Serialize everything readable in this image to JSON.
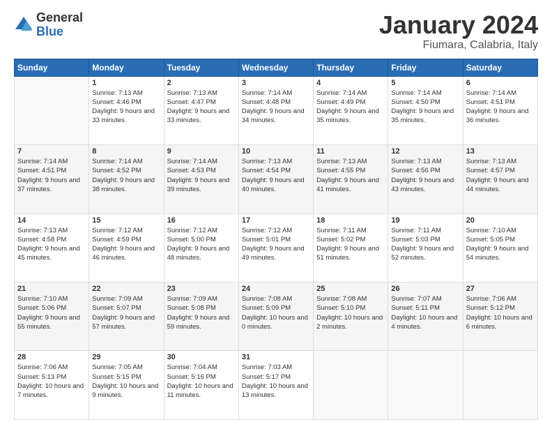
{
  "logo": {
    "general": "General",
    "blue": "Blue"
  },
  "title": "January 2024",
  "location": "Fiumara, Calabria, Italy",
  "headers": [
    "Sunday",
    "Monday",
    "Tuesday",
    "Wednesday",
    "Thursday",
    "Friday",
    "Saturday"
  ],
  "weeks": [
    [
      {
        "day": "",
        "sunrise": "",
        "sunset": "",
        "daylight": ""
      },
      {
        "day": "1",
        "sunrise": "Sunrise: 7:13 AM",
        "sunset": "Sunset: 4:46 PM",
        "daylight": "Daylight: 9 hours and 33 minutes."
      },
      {
        "day": "2",
        "sunrise": "Sunrise: 7:13 AM",
        "sunset": "Sunset: 4:47 PM",
        "daylight": "Daylight: 9 hours and 33 minutes."
      },
      {
        "day": "3",
        "sunrise": "Sunrise: 7:14 AM",
        "sunset": "Sunset: 4:48 PM",
        "daylight": "Daylight: 9 hours and 34 minutes."
      },
      {
        "day": "4",
        "sunrise": "Sunrise: 7:14 AM",
        "sunset": "Sunset: 4:49 PM",
        "daylight": "Daylight: 9 hours and 35 minutes."
      },
      {
        "day": "5",
        "sunrise": "Sunrise: 7:14 AM",
        "sunset": "Sunset: 4:50 PM",
        "daylight": "Daylight: 9 hours and 35 minutes."
      },
      {
        "day": "6",
        "sunrise": "Sunrise: 7:14 AM",
        "sunset": "Sunset: 4:51 PM",
        "daylight": "Daylight: 9 hours and 36 minutes."
      }
    ],
    [
      {
        "day": "7",
        "sunrise": "Sunrise: 7:14 AM",
        "sunset": "Sunset: 4:51 PM",
        "daylight": "Daylight: 9 hours and 37 minutes."
      },
      {
        "day": "8",
        "sunrise": "Sunrise: 7:14 AM",
        "sunset": "Sunset: 4:52 PM",
        "daylight": "Daylight: 9 hours and 38 minutes."
      },
      {
        "day": "9",
        "sunrise": "Sunrise: 7:14 AM",
        "sunset": "Sunset: 4:53 PM",
        "daylight": "Daylight: 9 hours and 39 minutes."
      },
      {
        "day": "10",
        "sunrise": "Sunrise: 7:13 AM",
        "sunset": "Sunset: 4:54 PM",
        "daylight": "Daylight: 9 hours and 40 minutes."
      },
      {
        "day": "11",
        "sunrise": "Sunrise: 7:13 AM",
        "sunset": "Sunset: 4:55 PM",
        "daylight": "Daylight: 9 hours and 41 minutes."
      },
      {
        "day": "12",
        "sunrise": "Sunrise: 7:13 AM",
        "sunset": "Sunset: 4:56 PM",
        "daylight": "Daylight: 9 hours and 43 minutes."
      },
      {
        "day": "13",
        "sunrise": "Sunrise: 7:13 AM",
        "sunset": "Sunset: 4:57 PM",
        "daylight": "Daylight: 9 hours and 44 minutes."
      }
    ],
    [
      {
        "day": "14",
        "sunrise": "Sunrise: 7:13 AM",
        "sunset": "Sunset: 4:58 PM",
        "daylight": "Daylight: 9 hours and 45 minutes."
      },
      {
        "day": "15",
        "sunrise": "Sunrise: 7:12 AM",
        "sunset": "Sunset: 4:59 PM",
        "daylight": "Daylight: 9 hours and 46 minutes."
      },
      {
        "day": "16",
        "sunrise": "Sunrise: 7:12 AM",
        "sunset": "Sunset: 5:00 PM",
        "daylight": "Daylight: 9 hours and 48 minutes."
      },
      {
        "day": "17",
        "sunrise": "Sunrise: 7:12 AM",
        "sunset": "Sunset: 5:01 PM",
        "daylight": "Daylight: 9 hours and 49 minutes."
      },
      {
        "day": "18",
        "sunrise": "Sunrise: 7:11 AM",
        "sunset": "Sunset: 5:02 PM",
        "daylight": "Daylight: 9 hours and 51 minutes."
      },
      {
        "day": "19",
        "sunrise": "Sunrise: 7:11 AM",
        "sunset": "Sunset: 5:03 PM",
        "daylight": "Daylight: 9 hours and 52 minutes."
      },
      {
        "day": "20",
        "sunrise": "Sunrise: 7:10 AM",
        "sunset": "Sunset: 5:05 PM",
        "daylight": "Daylight: 9 hours and 54 minutes."
      }
    ],
    [
      {
        "day": "21",
        "sunrise": "Sunrise: 7:10 AM",
        "sunset": "Sunset: 5:06 PM",
        "daylight": "Daylight: 9 hours and 55 minutes."
      },
      {
        "day": "22",
        "sunrise": "Sunrise: 7:09 AM",
        "sunset": "Sunset: 5:07 PM",
        "daylight": "Daylight: 9 hours and 57 minutes."
      },
      {
        "day": "23",
        "sunrise": "Sunrise: 7:09 AM",
        "sunset": "Sunset: 5:08 PM",
        "daylight": "Daylight: 9 hours and 59 minutes."
      },
      {
        "day": "24",
        "sunrise": "Sunrise: 7:08 AM",
        "sunset": "Sunset: 5:09 PM",
        "daylight": "Daylight: 10 hours and 0 minutes."
      },
      {
        "day": "25",
        "sunrise": "Sunrise: 7:08 AM",
        "sunset": "Sunset: 5:10 PM",
        "daylight": "Daylight: 10 hours and 2 minutes."
      },
      {
        "day": "26",
        "sunrise": "Sunrise: 7:07 AM",
        "sunset": "Sunset: 5:11 PM",
        "daylight": "Daylight: 10 hours and 4 minutes."
      },
      {
        "day": "27",
        "sunrise": "Sunrise: 7:06 AM",
        "sunset": "Sunset: 5:12 PM",
        "daylight": "Daylight: 10 hours and 6 minutes."
      }
    ],
    [
      {
        "day": "28",
        "sunrise": "Sunrise: 7:06 AM",
        "sunset": "Sunset: 5:13 PM",
        "daylight": "Daylight: 10 hours and 7 minutes."
      },
      {
        "day": "29",
        "sunrise": "Sunrise: 7:05 AM",
        "sunset": "Sunset: 5:15 PM",
        "daylight": "Daylight: 10 hours and 9 minutes."
      },
      {
        "day": "30",
        "sunrise": "Sunrise: 7:04 AM",
        "sunset": "Sunset: 5:16 PM",
        "daylight": "Daylight: 10 hours and 11 minutes."
      },
      {
        "day": "31",
        "sunrise": "Sunrise: 7:03 AM",
        "sunset": "Sunset: 5:17 PM",
        "daylight": "Daylight: 10 hours and 13 minutes."
      },
      {
        "day": "",
        "sunrise": "",
        "sunset": "",
        "daylight": ""
      },
      {
        "day": "",
        "sunrise": "",
        "sunset": "",
        "daylight": ""
      },
      {
        "day": "",
        "sunrise": "",
        "sunset": "",
        "daylight": ""
      }
    ]
  ]
}
